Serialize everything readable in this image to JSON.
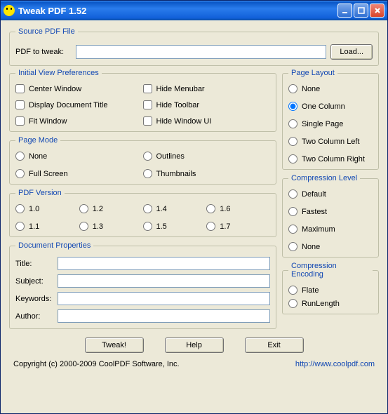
{
  "window": {
    "title": "Tweak PDF 1.52"
  },
  "source": {
    "legend": "Source PDF File",
    "label": "PDF to tweak:",
    "value": "",
    "load": "Load..."
  },
  "ivp": {
    "legend": "Initial View Preferences",
    "center": "Center Window",
    "display_title": "Display Document Title",
    "fit": "Fit Window",
    "hide_menubar": "Hide Menubar",
    "hide_toolbar": "Hide Toolbar",
    "hide_window_ui": "Hide Window UI"
  },
  "page_mode": {
    "legend": "Page Mode",
    "none": "None",
    "full": "Full Screen",
    "outlines": "Outlines",
    "thumbs": "Thumbnails"
  },
  "pdf_version": {
    "legend": "PDF Version",
    "v10": "1.0",
    "v12": "1.2",
    "v14": "1.4",
    "v16": "1.6",
    "v11": "1.1",
    "v13": "1.3",
    "v15": "1.5",
    "v17": "1.7"
  },
  "doc_props": {
    "legend": "Document Properties",
    "title_lbl": "Title:",
    "title": "",
    "subject_lbl": "Subject:",
    "subject": "",
    "keywords_lbl": "Keywords:",
    "keywords": "",
    "author_lbl": "Author:",
    "author": ""
  },
  "page_layout": {
    "legend": "Page Layout",
    "none": "None",
    "one_column": "One Column",
    "single_page": "Single Page",
    "two_left": "Two Column Left",
    "two_right": "Two Column Right",
    "selected": "one_column"
  },
  "compression_level": {
    "legend": "Compression Level",
    "default": "Default",
    "fastest": "Fastest",
    "maximum": "Maximum",
    "none": "None"
  },
  "compression_encoding": {
    "legend": "Compression Encoding",
    "flate": "Flate",
    "runlength": "RunLength"
  },
  "buttons": {
    "tweak": "Tweak!",
    "help": "Help",
    "exit": "Exit"
  },
  "footer": {
    "copyright": "Copyright (c) 2000-2009 CoolPDF Software, Inc.",
    "link": "http://www.coolpdf.com"
  }
}
